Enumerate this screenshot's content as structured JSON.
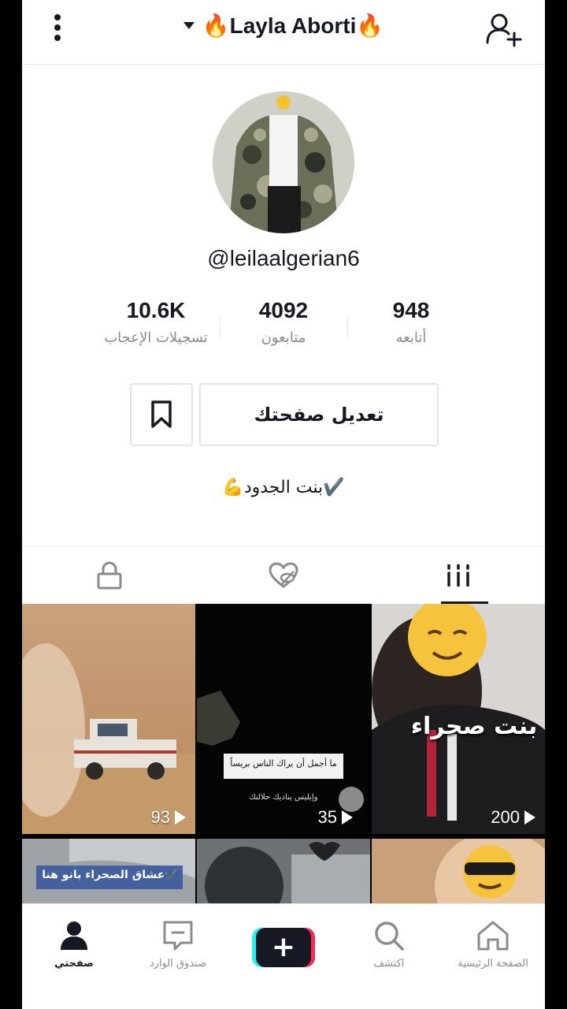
{
  "header": {
    "title": "Layla Aborti",
    "title_emoji_left": "🔥",
    "title_emoji_right": "🔥"
  },
  "profile": {
    "username": "@leilaalgerian6",
    "bio": "💪بنت الجدود✔️",
    "stats": [
      {
        "value": "948",
        "label": "أتابعه"
      },
      {
        "value": "4092",
        "label": "متابعون"
      },
      {
        "value": "10.6K",
        "label": "تسجيلات الإعجاب"
      }
    ],
    "edit_label": "تعديل صفحتك"
  },
  "videos": [
    {
      "views": "200",
      "overlay_text": "بنت صحراء"
    },
    {
      "views": "35",
      "overlay_text": "ما أجمل أن يراك الناس بريساً",
      "overlay_sub": "وإبليس يناديك حلالنك"
    },
    {
      "views": "93"
    },
    {
      "overlay_text": "عشاق الصحراء بانو هنا✔️"
    }
  ],
  "nav": {
    "home": "الصفحة الرئيسية",
    "discover": "اكتشف",
    "inbox": "صندوق الوارد",
    "me": "صفحتي",
    "create": "+"
  },
  "colors": {
    "text": "#161823",
    "muted": "#8a8b91",
    "accent_cyan": "#25f4ee",
    "accent_red": "#fe2c55"
  }
}
